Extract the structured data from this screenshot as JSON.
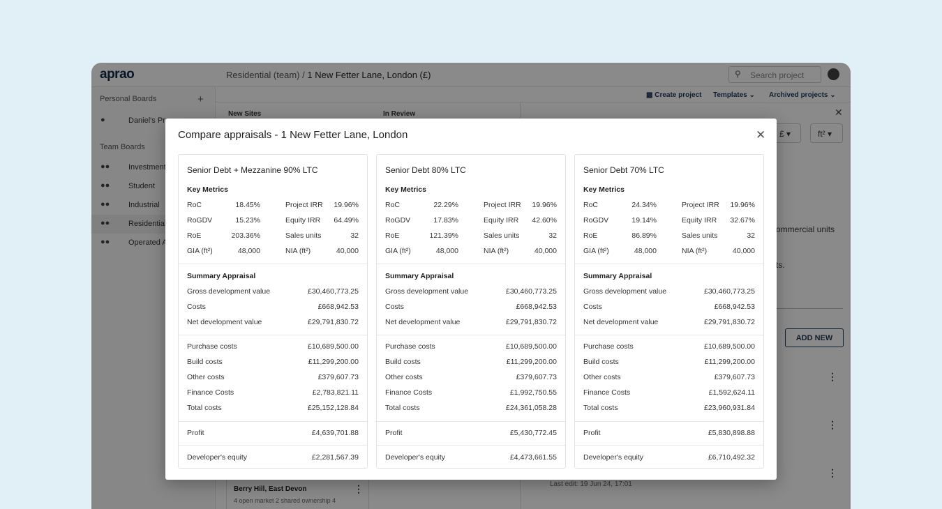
{
  "app": {
    "logo": "aprao",
    "breadcrumb_team": "Residential (team)",
    "breadcrumb_sep": "/",
    "breadcrumb_project": "1 New Fetter Lane, London (£)",
    "search_placeholder": "Search project"
  },
  "sidebar": {
    "personal_header": "Personal Boards",
    "add": "+",
    "personal_items": [
      {
        "label": "Daniel's Pro"
      }
    ],
    "team_header": "Team Boards",
    "team_items": [
      {
        "label": "Investment"
      },
      {
        "label": "Student"
      },
      {
        "label": "Industrial"
      },
      {
        "label": "Residential",
        "active": true
      },
      {
        "label": "Operated A"
      }
    ]
  },
  "actions": {
    "create": "Create project",
    "templates": "Templates",
    "archived": "Archived projects"
  },
  "board": {
    "columns": [
      "New Sites",
      "In Review"
    ],
    "card_title": "Berry Hill, East Devon",
    "card_desc": "4 open market 2 shared ownership 4"
  },
  "panel": {
    "currency": "£",
    "unit": "ft²",
    "text1": "ommercial units",
    "text2": "ts.",
    "add_new": "ADD NEW",
    "last_edit": "Last edit: 19 Jun 24, 17:01"
  },
  "modal": {
    "title": "Compare appraisals - 1 New Fetter Lane, London",
    "key_metrics_label": "Key Metrics",
    "summary_label": "Summary Appraisal",
    "cards": [
      {
        "title": "Senior Debt + Mezzanine 90% LTC",
        "metrics": [
          [
            "RoC",
            "18.45%",
            "Project IRR",
            "19.96%"
          ],
          [
            "RoGDV",
            "15.23%",
            "Equity IRR",
            "64.49%"
          ],
          [
            "RoE",
            "203.36%",
            "Sales units",
            "32"
          ],
          [
            "GIA (ft²)",
            "48,000",
            "NIA (ft²)",
            "40,000"
          ]
        ],
        "summary": [
          [
            "Gross development value",
            "£30,460,773.25"
          ],
          [
            "Costs",
            "£668,942.53"
          ],
          [
            "Net development value",
            "£29,791,830.72"
          ]
        ],
        "costs": [
          [
            "Purchase costs",
            "£10,689,500.00"
          ],
          [
            "Build costs",
            "£11,299,200.00"
          ],
          [
            "Other costs",
            "£379,607.73"
          ],
          [
            "Finance Costs",
            "£2,783,821.11"
          ],
          [
            "Total costs",
            "£25,152,128.84"
          ]
        ],
        "profit": [
          "Profit",
          "£4,639,701.88"
        ],
        "equity": [
          "Developer's equity",
          "£2,281,567.39"
        ]
      },
      {
        "title": "Senior Debt 80% LTC",
        "metrics": [
          [
            "RoC",
            "22.29%",
            "Project IRR",
            "19.96%"
          ],
          [
            "RoGDV",
            "17.83%",
            "Equity IRR",
            "42.60%"
          ],
          [
            "RoE",
            "121.39%",
            "Sales units",
            "32"
          ],
          [
            "GIA (ft²)",
            "48,000",
            "NIA (ft²)",
            "40,000"
          ]
        ],
        "summary": [
          [
            "Gross development value",
            "£30,460,773.25"
          ],
          [
            "Costs",
            "£668,942.53"
          ],
          [
            "Net development value",
            "£29,791,830.72"
          ]
        ],
        "costs": [
          [
            "Purchase costs",
            "£10,689,500.00"
          ],
          [
            "Build costs",
            "£11,299,200.00"
          ],
          [
            "Other costs",
            "£379,607.73"
          ],
          [
            "Finance Costs",
            "£1,992,750.55"
          ],
          [
            "Total costs",
            "£24,361,058.28"
          ]
        ],
        "profit": [
          "Profit",
          "£5,430,772.45"
        ],
        "equity": [
          "Developer's equity",
          "£4,473,661.55"
        ]
      },
      {
        "title": "Senior Debt 70% LTC",
        "metrics": [
          [
            "RoC",
            "24.34%",
            "Project IRR",
            "19.96%"
          ],
          [
            "RoGDV",
            "19.14%",
            "Equity IRR",
            "32.67%"
          ],
          [
            "RoE",
            "86.89%",
            "Sales units",
            "32"
          ],
          [
            "GIA (ft²)",
            "48,000",
            "NIA (ft²)",
            "40,000"
          ]
        ],
        "summary": [
          [
            "Gross development value",
            "£30,460,773.25"
          ],
          [
            "Costs",
            "£668,942.53"
          ],
          [
            "Net development value",
            "£29,791,830.72"
          ]
        ],
        "costs": [
          [
            "Purchase costs",
            "£10,689,500.00"
          ],
          [
            "Build costs",
            "£11,299,200.00"
          ],
          [
            "Other costs",
            "£379,607.73"
          ],
          [
            "Finance Costs",
            "£1,592,624.11"
          ],
          [
            "Total costs",
            "£23,960,931.84"
          ]
        ],
        "profit": [
          "Profit",
          "£5,830,898.88"
        ],
        "equity": [
          "Developer's equity",
          "£6,710,492.32"
        ]
      }
    ]
  }
}
